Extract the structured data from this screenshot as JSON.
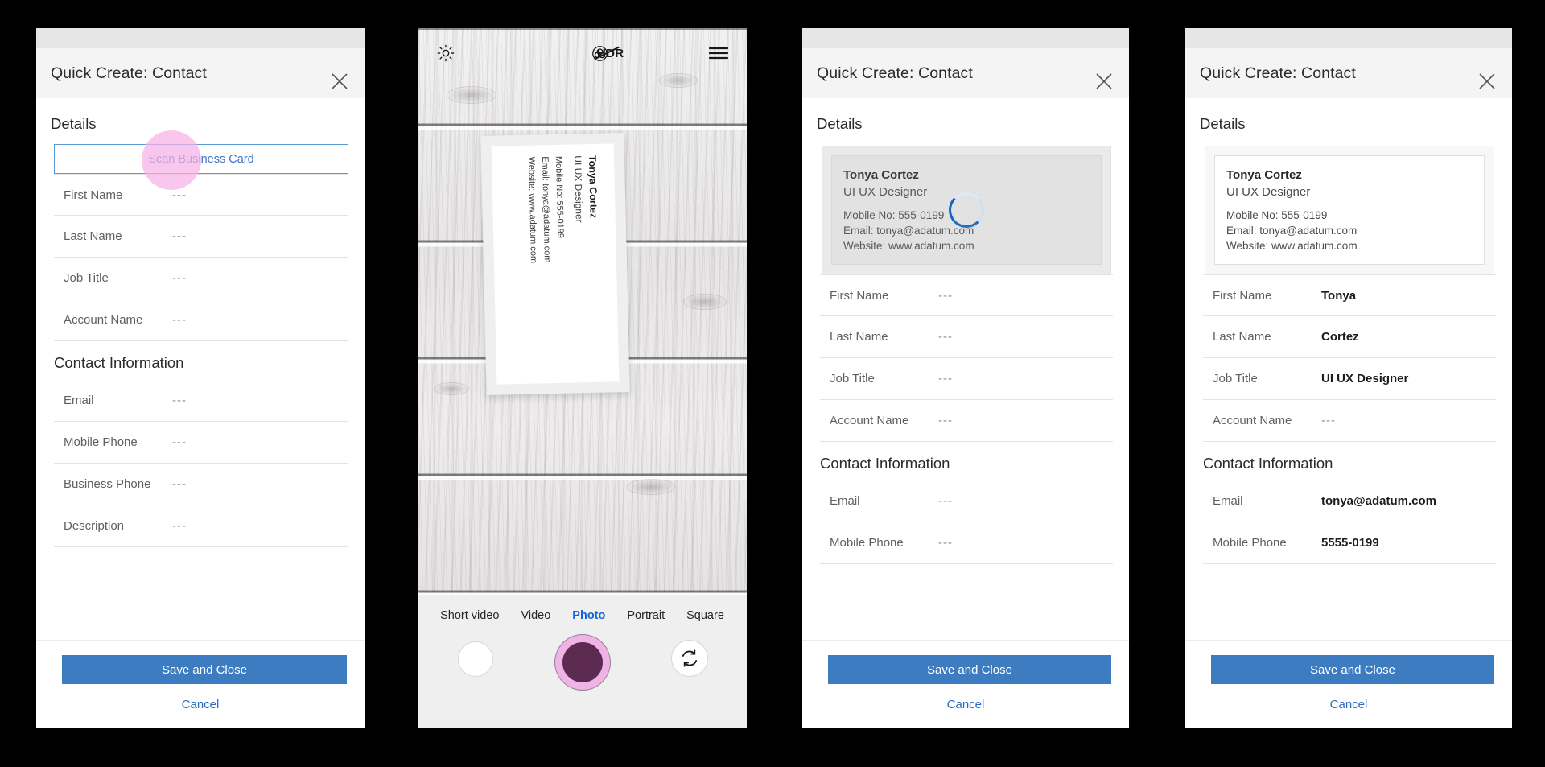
{
  "dialog": {
    "title": "Quick Create: Contact",
    "close_icon": "close-icon",
    "details_heading": "Details",
    "contact_heading": "Contact Information",
    "scan_button": "Scan Business Card",
    "save_button": "Save and Close",
    "cancel_button": "Cancel",
    "empty_value": "---",
    "accent_color": "#3d7cc0",
    "link_color": "#2a6cc4"
  },
  "panel1": {
    "fields": [
      {
        "label": "First Name",
        "value": "---"
      },
      {
        "label": "Last Name",
        "value": "---"
      },
      {
        "label": "Job Title",
        "value": "---"
      },
      {
        "label": "Account Name",
        "value": "---"
      }
    ],
    "contact_fields": [
      {
        "label": "Email",
        "value": "---"
      },
      {
        "label": "Mobile Phone",
        "value": "---"
      },
      {
        "label": "Business Phone",
        "value": "---"
      },
      {
        "label": "Description",
        "value": "---"
      }
    ]
  },
  "panel3": {
    "card": {
      "name": "Tonya Cortez",
      "job_title": "UI UX Designer",
      "mobile": "Mobile No: 555-0199",
      "email": "Email: tonya@adatum.com",
      "website": "Website: www.adatum.com"
    },
    "loading_spinner": "progress-spinner",
    "fields": [
      {
        "label": "First Name",
        "value": "---"
      },
      {
        "label": "Last Name",
        "value": "---"
      },
      {
        "label": "Job Title",
        "value": "---"
      },
      {
        "label": "Account Name",
        "value": "---"
      }
    ],
    "contact_fields": [
      {
        "label": "Email",
        "value": "---"
      },
      {
        "label": "Mobile Phone",
        "value": "---"
      }
    ]
  },
  "panel4": {
    "card": {
      "name": "Tonya Cortez",
      "job_title": "UI UX Designer",
      "mobile": "Mobile No: 555-0199",
      "email": "Email: tonya@adatum.com",
      "website": "Website: www.adatum.com"
    },
    "fields": [
      {
        "label": "First Name",
        "value": "Tonya",
        "filled": true
      },
      {
        "label": "Last Name",
        "value": "Cortez",
        "filled": true
      },
      {
        "label": "Job Title",
        "value": "UI UX Designer",
        "filled": true
      },
      {
        "label": "Account Name",
        "value": "---",
        "filled": false
      }
    ],
    "contact_fields": [
      {
        "label": "Email",
        "value": "tonya@adatum.com",
        "filled": true
      },
      {
        "label": "Mobile Phone",
        "value": "5555-0199",
        "filled": true
      }
    ]
  },
  "camera": {
    "topbar": [
      {
        "name": "brightness-icon",
        "label": ""
      },
      {
        "name": "hdr-off-icon",
        "label": "HDR"
      },
      {
        "name": "color-lens-icon",
        "label": ""
      },
      {
        "name": "hamburger-menu-icon",
        "label": ""
      }
    ],
    "modes": [
      {
        "label": "Short video",
        "active": false
      },
      {
        "label": "Video",
        "active": false
      },
      {
        "label": "Photo",
        "active": true
      },
      {
        "label": "Portrait",
        "active": false
      },
      {
        "label": "Square",
        "active": false
      }
    ],
    "active_mode_color": "#1565d8",
    "shutter_ring_color": "#f0b3e6",
    "shutter_core_color": "#5d2a52",
    "gallery_button": "gallery-thumbnail-button",
    "flip_button": "switch-camera-icon",
    "business_card": {
      "name": "Tonya Cortez",
      "job_title": "UI UX Designer",
      "mobile": "Mobile No: 555-0199",
      "email": "Email: tonya@adatum.com",
      "website": "Website: www.adatum.com"
    }
  }
}
